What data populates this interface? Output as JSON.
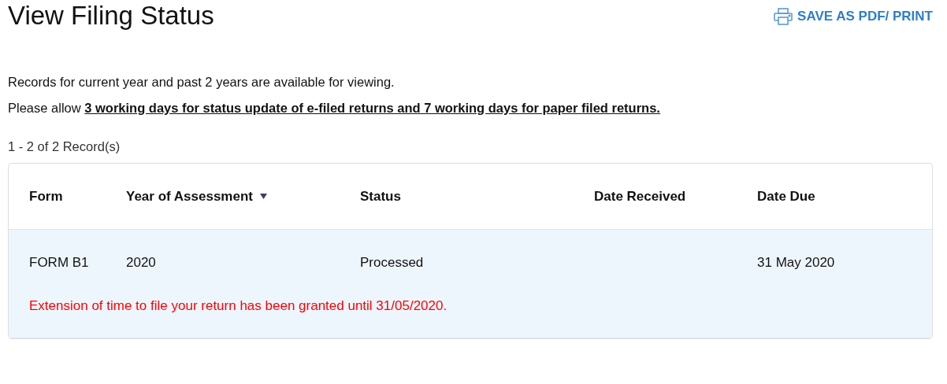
{
  "page_title": "View Filing Status",
  "print_button": {
    "label": "SAVE AS PDF/ PRINT"
  },
  "notes": [
    "Records for current year and past 2 years are available for viewing.",
    "Please allow **3 working days for status update of e-filed returns and 7 working days for paper filed returns.**"
  ],
  "record_count": "1 - 2 of 2 Record(s)",
  "table": {
    "columns": [
      {
        "label": "Form",
        "sorted_descending": false
      },
      {
        "label": "Year of Assessment",
        "sorted_descending": true
      },
      {
        "label": "Status",
        "sorted_descending": false
      },
      {
        "label": "Date Received",
        "sorted_descending": false
      },
      {
        "label": "Date Due",
        "sorted_descending": false
      }
    ],
    "rows": [
      {
        "highlighted": true,
        "cells": [
          "FORM B1",
          "2020",
          "Processed",
          "",
          "31 May 2020"
        ],
        "message": "Extension of time to file your return has been granted until 31/05/2020."
      }
    ]
  }
}
